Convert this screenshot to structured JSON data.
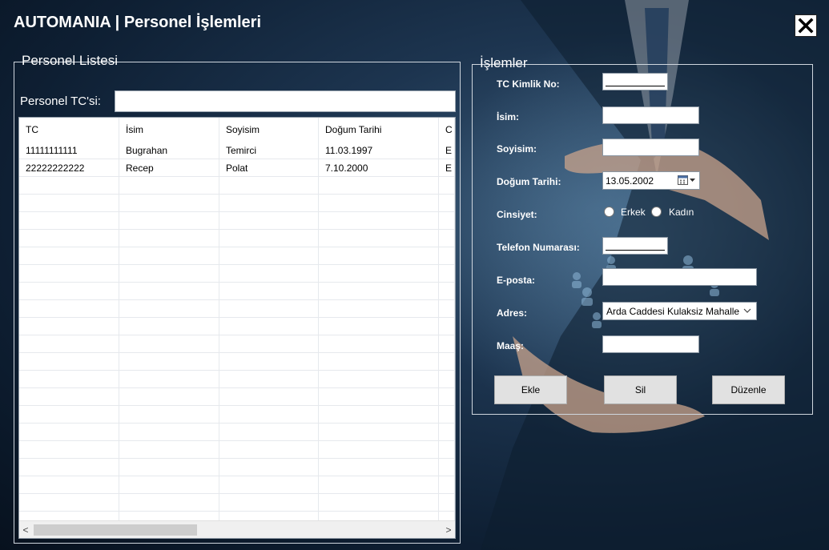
{
  "window": {
    "title": "AUTOMANIA | Personel İşlemleri"
  },
  "personel": {
    "legend": "Personel Listesi",
    "search_label": "Personel TC'si:",
    "search_value": "",
    "columns": [
      "TC",
      "İsim",
      "Soyisim",
      "Doğum Tarihi",
      "C"
    ],
    "rows": [
      [
        "11111111111",
        "Bugrahan",
        "Temirci",
        "11.03.1997",
        "E"
      ],
      [
        "22222222222",
        "Recep",
        "Polat",
        "7.10.2000",
        "E"
      ]
    ],
    "scroll_left": "<",
    "scroll_right": ">"
  },
  "islemler": {
    "legend": "İşlemler",
    "tc_label": "TC Kimlik No:",
    "isim_label": "İsim:",
    "soyisim_label": "Soyisim:",
    "dogum_label": "Doğum Tarihi:",
    "dogum_value": "13.05.2002",
    "cinsiyet_label": "Cinsiyet:",
    "erkek_label": "Erkek",
    "kadin_label": "Kadın",
    "telefon_label": "Telefon Numarası:",
    "eposta_label": "E-posta:",
    "adres_label": "Adres:",
    "adres_value": "Arda Caddesi Kulaksiz Mahalle",
    "maas_label": "Maaş:",
    "ekle_label": "Ekle",
    "sil_label": "Sil",
    "duzenle_label": "Düzenle"
  },
  "icons": {
    "close": "close-icon",
    "calendar": "calendar-icon",
    "dropdown": "chevron-down-icon"
  }
}
